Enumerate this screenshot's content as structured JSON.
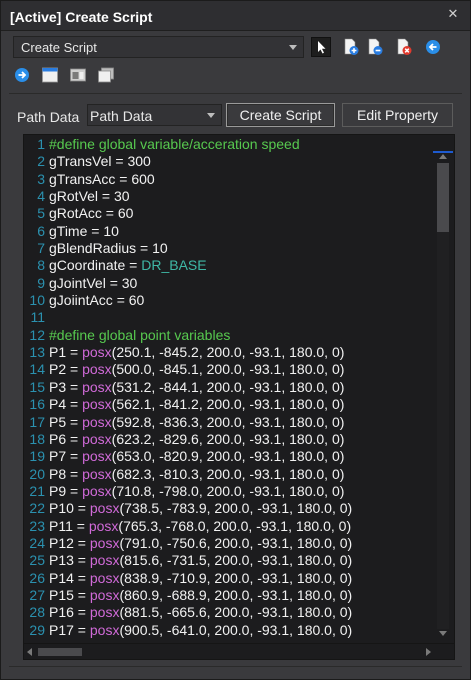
{
  "window": {
    "title": "[Active] Create Script",
    "close_glyph": "✕"
  },
  "toolbar": {
    "script_type_selected": "Create Script",
    "icons": [
      "pointer-icon",
      "add-document-icon",
      "remove-document-icon",
      "delete-document-icon",
      "back-arrow-icon",
      "forward-arrow-icon",
      "window-icon",
      "panel-icon",
      "copy-window-icon"
    ]
  },
  "path": {
    "label": "Path Data",
    "selected": "Path Data",
    "create_button": "Create Script",
    "edit_button": "Edit Property"
  },
  "editor": {
    "lines": [
      {
        "n": "1",
        "parts": [
          {
            "t": "#define global variable/acceration speed",
            "c": "comment"
          }
        ]
      },
      {
        "n": "2",
        "parts": [
          {
            "t": "gTransVel = 300",
            "c": ""
          }
        ]
      },
      {
        "n": "3",
        "parts": [
          {
            "t": "gTransAcc = 600",
            "c": ""
          }
        ]
      },
      {
        "n": "4",
        "parts": [
          {
            "t": "gRotVel = 30",
            "c": ""
          }
        ]
      },
      {
        "n": "5",
        "parts": [
          {
            "t": "gRotAcc = 60",
            "c": ""
          }
        ]
      },
      {
        "n": "6",
        "parts": [
          {
            "t": "gTime = 10",
            "c": ""
          }
        ]
      },
      {
        "n": "7",
        "parts": [
          {
            "t": "gBlendRadius = 10",
            "c": ""
          }
        ]
      },
      {
        "n": "8",
        "parts": [
          {
            "t": "gCoordinate = ",
            "c": ""
          },
          {
            "t": "DR_BASE",
            "c": "const"
          }
        ]
      },
      {
        "n": "9",
        "parts": [
          {
            "t": "gJointVel = 30",
            "c": ""
          }
        ]
      },
      {
        "n": "10",
        "parts": [
          {
            "t": "gJoiintAcc = 60",
            "c": ""
          }
        ]
      },
      {
        "n": "11",
        "parts": [
          {
            "t": "",
            "c": ""
          }
        ]
      },
      {
        "n": "12",
        "parts": [
          {
            "t": "#define global point variables",
            "c": "comment"
          }
        ]
      },
      {
        "n": "13",
        "parts": [
          {
            "t": "P1 = ",
            "c": ""
          },
          {
            "t": "posx",
            "c": "func"
          },
          {
            "t": "(250.1, -845.2, 200.0, -93.1, 180.0, 0)",
            "c": ""
          }
        ]
      },
      {
        "n": "14",
        "parts": [
          {
            "t": "P2 = ",
            "c": ""
          },
          {
            "t": "posx",
            "c": "func"
          },
          {
            "t": "(500.0, -845.1, 200.0, -93.1, 180.0, 0)",
            "c": ""
          }
        ]
      },
      {
        "n": "15",
        "parts": [
          {
            "t": "P3 = ",
            "c": ""
          },
          {
            "t": "posx",
            "c": "func"
          },
          {
            "t": "(531.2, -844.1, 200.0, -93.1, 180.0, 0)",
            "c": ""
          }
        ]
      },
      {
        "n": "16",
        "parts": [
          {
            "t": "P4 = ",
            "c": ""
          },
          {
            "t": "posx",
            "c": "func"
          },
          {
            "t": "(562.1, -841.2, 200.0, -93.1, 180.0, 0)",
            "c": ""
          }
        ]
      },
      {
        "n": "17",
        "parts": [
          {
            "t": "P5 = ",
            "c": ""
          },
          {
            "t": "posx",
            "c": "func"
          },
          {
            "t": "(592.8, -836.3, 200.0, -93.1, 180.0, 0)",
            "c": ""
          }
        ]
      },
      {
        "n": "18",
        "parts": [
          {
            "t": "P6 = ",
            "c": ""
          },
          {
            "t": "posx",
            "c": "func"
          },
          {
            "t": "(623.2, -829.6, 200.0, -93.1, 180.0, 0)",
            "c": ""
          }
        ]
      },
      {
        "n": "19",
        "parts": [
          {
            "t": "P7 = ",
            "c": ""
          },
          {
            "t": "posx",
            "c": "func"
          },
          {
            "t": "(653.0, -820.9, 200.0, -93.1, 180.0, 0)",
            "c": ""
          }
        ]
      },
      {
        "n": "20",
        "parts": [
          {
            "t": "P8 = ",
            "c": ""
          },
          {
            "t": "posx",
            "c": "func"
          },
          {
            "t": "(682.3, -810.3, 200.0, -93.1, 180.0, 0)",
            "c": ""
          }
        ]
      },
      {
        "n": "21",
        "parts": [
          {
            "t": "P9 = ",
            "c": ""
          },
          {
            "t": "posx",
            "c": "func"
          },
          {
            "t": "(710.8, -798.0, 200.0, -93.1, 180.0, 0)",
            "c": ""
          }
        ]
      },
      {
        "n": "22",
        "parts": [
          {
            "t": "P10 = ",
            "c": ""
          },
          {
            "t": "posx",
            "c": "func"
          },
          {
            "t": "(738.5, -783.9, 200.0, -93.1, 180.0, 0)",
            "c": ""
          }
        ]
      },
      {
        "n": "23",
        "parts": [
          {
            "t": "P11 = ",
            "c": ""
          },
          {
            "t": "posx",
            "c": "func"
          },
          {
            "t": "(765.3, -768.0, 200.0, -93.1, 180.0, 0)",
            "c": ""
          }
        ]
      },
      {
        "n": "24",
        "parts": [
          {
            "t": "P12 = ",
            "c": ""
          },
          {
            "t": "posx",
            "c": "func"
          },
          {
            "t": "(791.0, -750.6, 200.0, -93.1, 180.0, 0)",
            "c": ""
          }
        ]
      },
      {
        "n": "25",
        "parts": [
          {
            "t": "P13 = ",
            "c": ""
          },
          {
            "t": "posx",
            "c": "func"
          },
          {
            "t": "(815.6, -731.5, 200.0, -93.1, 180.0, 0)",
            "c": ""
          }
        ]
      },
      {
        "n": "26",
        "parts": [
          {
            "t": "P14 = ",
            "c": ""
          },
          {
            "t": "posx",
            "c": "func"
          },
          {
            "t": "(838.9, -710.9, 200.0, -93.1, 180.0, 0)",
            "c": ""
          }
        ]
      },
      {
        "n": "27",
        "parts": [
          {
            "t": "P15 = ",
            "c": ""
          },
          {
            "t": "posx",
            "c": "func"
          },
          {
            "t": "(860.9, -688.9, 200.0, -93.1, 180.0, 0)",
            "c": ""
          }
        ]
      },
      {
        "n": "28",
        "parts": [
          {
            "t": "P16 = ",
            "c": ""
          },
          {
            "t": "posx",
            "c": "func"
          },
          {
            "t": "(881.5, -665.6, 200.0, -93.1, 180.0, 0)",
            "c": ""
          }
        ]
      },
      {
        "n": "29",
        "parts": [
          {
            "t": "P17 = ",
            "c": ""
          },
          {
            "t": "posx",
            "c": "func"
          },
          {
            "t": "(900.5, -641.0, 200.0, -93.1, 180.0, 0)",
            "c": ""
          }
        ]
      }
    ]
  },
  "colors": {
    "comment": "#57c94f",
    "constant": "#3fb8a6",
    "function": "#d06ad8",
    "line_number": "#2b91af",
    "accent_blue": "#1e5bd0"
  }
}
